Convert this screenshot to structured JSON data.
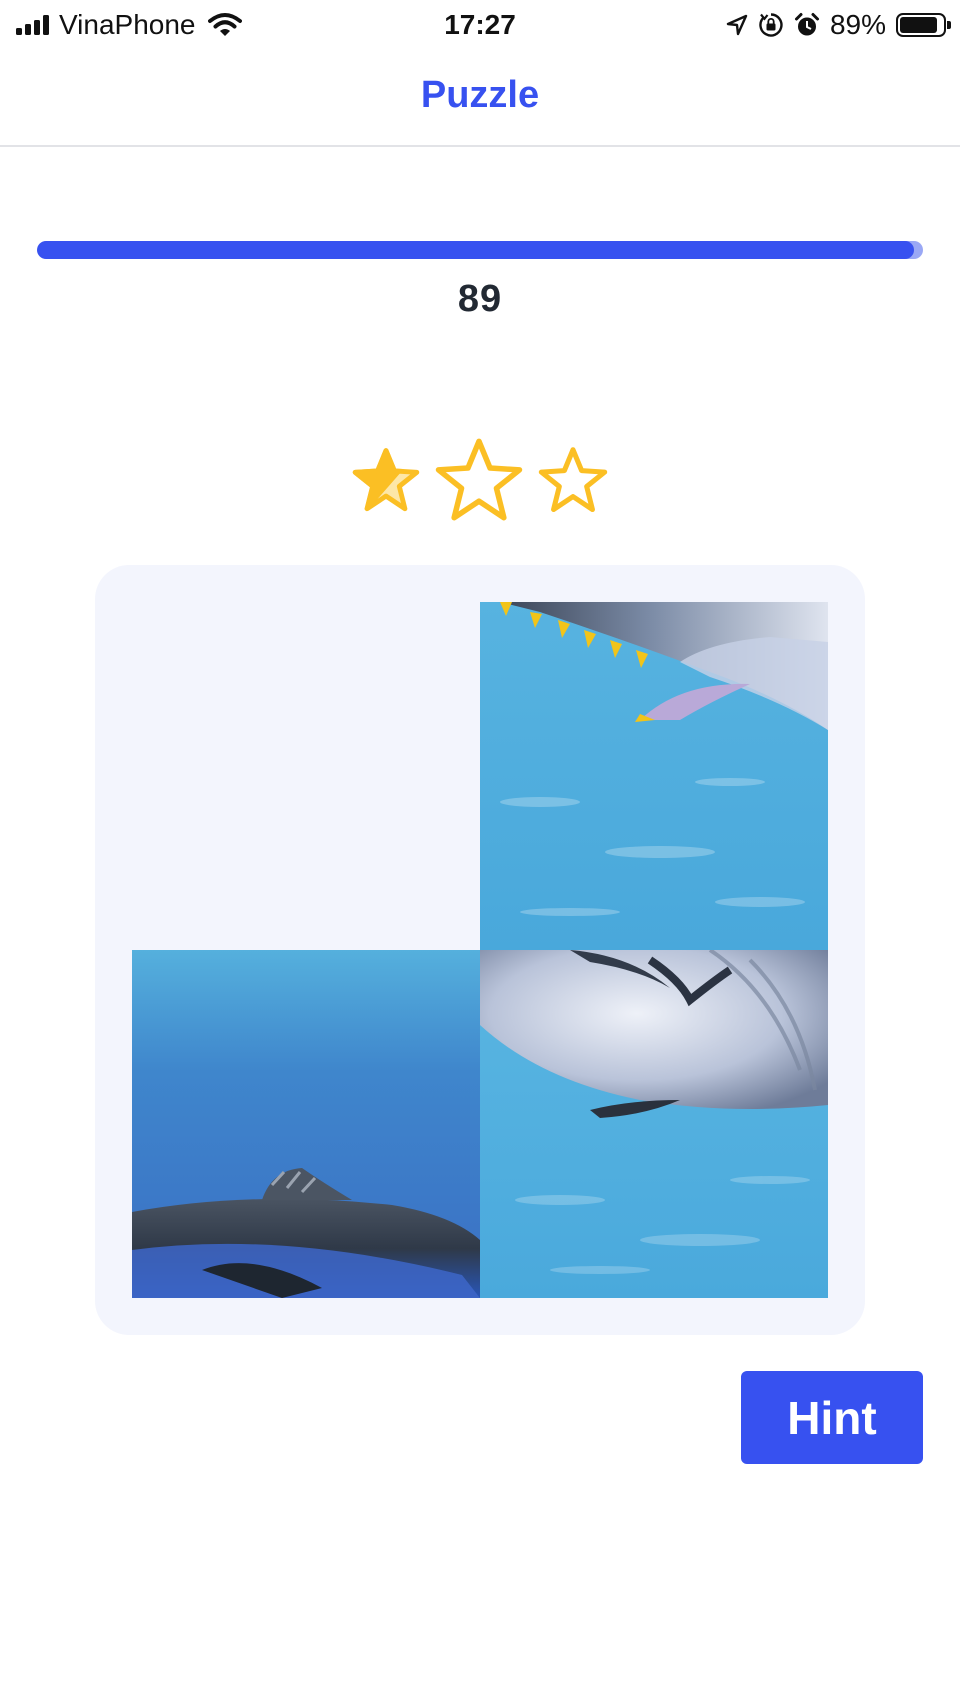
{
  "status_bar": {
    "carrier": "VinaPhone",
    "time": "17:27",
    "battery": "89%",
    "icons": [
      "signal-icon",
      "wifi-icon",
      "location-arrow-icon",
      "rotation-lock-icon",
      "alarm-icon",
      "battery-icon"
    ]
  },
  "nav": {
    "title": "Puzzle"
  },
  "timer": {
    "value": "89",
    "progress_fraction": 0.99
  },
  "rating": {
    "filled_stars": 0.5,
    "total_stars": 3
  },
  "puzzle": {
    "grid": "2x2",
    "tiles": [
      {
        "slot": "top-left",
        "content": "empty"
      },
      {
        "slot": "top-right",
        "content": "marlin-dorsal-fin-piece"
      },
      {
        "slot": "bottom-left",
        "content": "marlin-back-fin-piece"
      },
      {
        "slot": "bottom-right",
        "content": "marlin-head-piece"
      }
    ]
  },
  "actions": {
    "hint_label": "Hint"
  },
  "colors": {
    "accent": "#3751f0",
    "star": "#fbbf24",
    "board_bg": "#f3f5fd"
  }
}
